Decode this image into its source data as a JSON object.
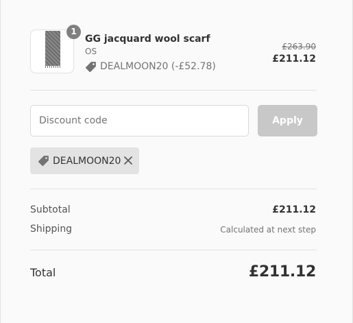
{
  "product": {
    "name": "GG jacquard wool scarf",
    "variant": "OS",
    "quantity": "1",
    "discount_line": "DEALMOON20 (-£52.78)",
    "original_price": "£263.90",
    "final_price": "£211.12",
    "image_icon": "scarf-thumbnail"
  },
  "discount_form": {
    "placeholder": "Discount code",
    "value": "",
    "apply_label": "Apply",
    "applied_code": "DEALMOON20"
  },
  "summary": {
    "subtotal_label": "Subtotal",
    "subtotal_value": "£211.12",
    "shipping_label": "Shipping",
    "shipping_value": "Calculated at next step",
    "total_label": "Total",
    "total_value": "£211.12"
  },
  "icons": {
    "discount_tag": "tag-icon",
    "remove_code": "close-icon"
  },
  "colors": {
    "background": "#fafafa",
    "apply_button_disabled": "#c8c8c8",
    "chip_background": "#e3e3e3",
    "badge": "#727272"
  }
}
